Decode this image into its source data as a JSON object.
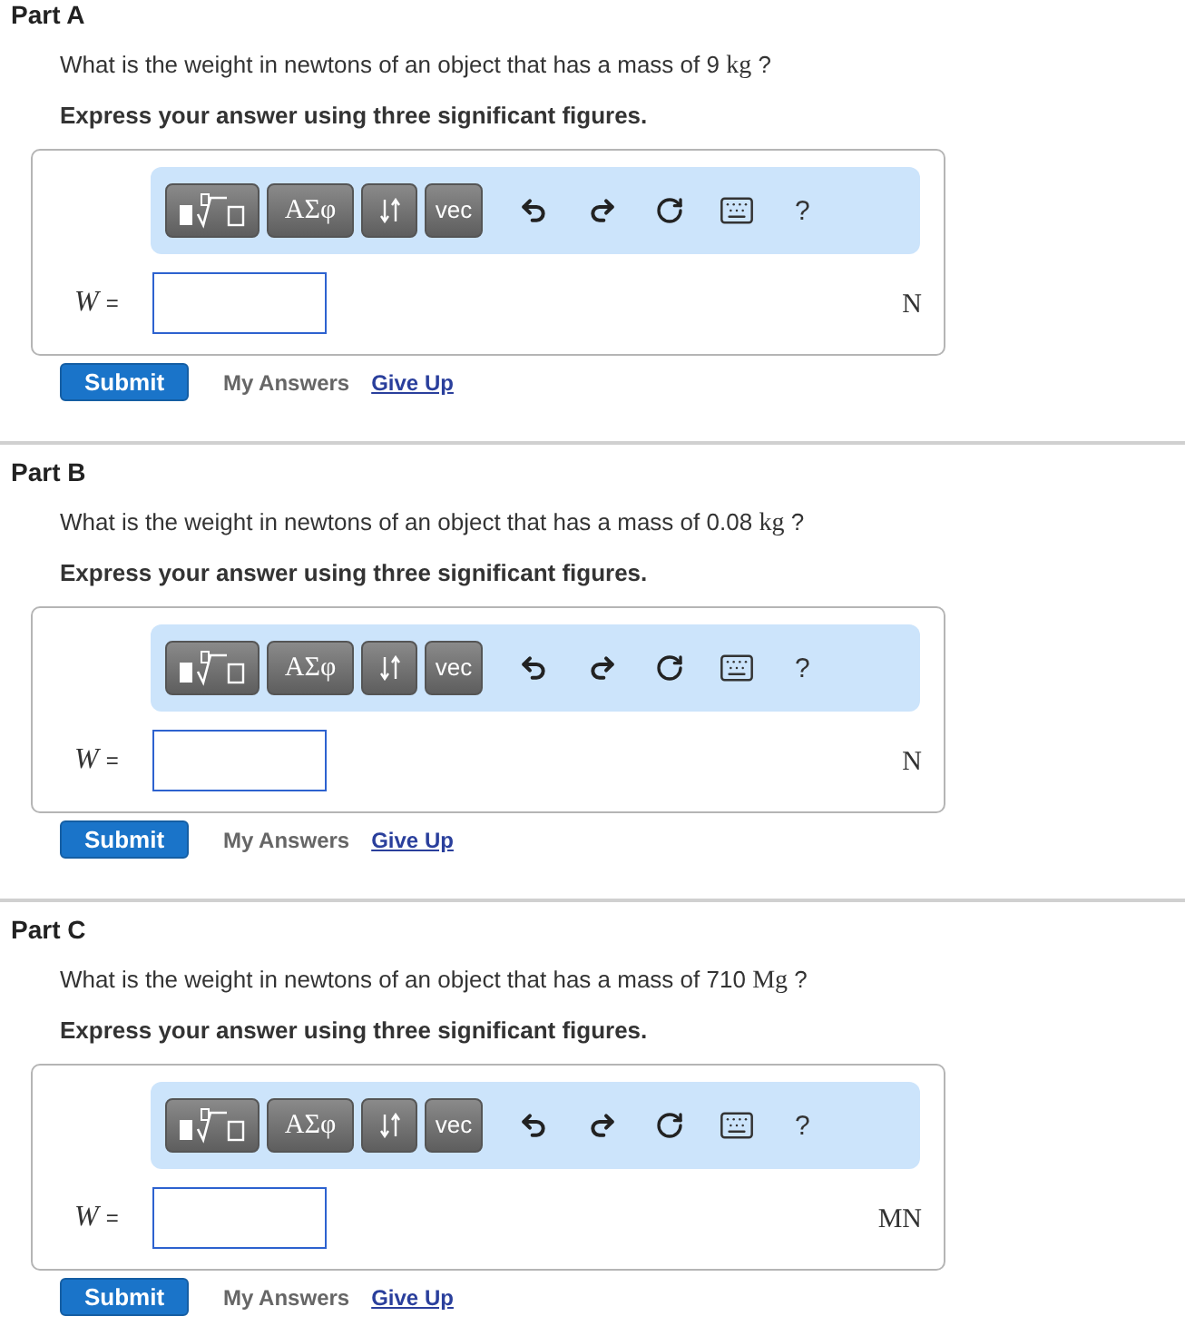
{
  "parts": [
    {
      "title": "Part A",
      "question": {
        "text": "What is the weight in newtons of an object that has a mass of 9",
        "unit": "kg",
        "end": "?"
      },
      "instruction": "Express your answer using three significant figures.",
      "toolbar": {
        "symbols": "ΑΣφ",
        "vector": "vec",
        "help": "?"
      },
      "answer": {
        "variable": "W",
        "equals": "=",
        "unit": "N"
      },
      "submit": "Submit",
      "my_answers": "My Answers",
      "give_up": "Give Up"
    },
    {
      "title": "Part B",
      "question": {
        "text": "What is the weight in newtons of an object that has a mass of 0.08",
        "unit": "kg",
        "end": "?"
      },
      "instruction": "Express your answer using three significant figures.",
      "toolbar": {
        "symbols": "ΑΣφ",
        "vector": "vec",
        "help": "?"
      },
      "answer": {
        "variable": "W",
        "equals": "=",
        "unit": "N"
      },
      "submit": "Submit",
      "my_answers": "My Answers",
      "give_up": "Give Up"
    },
    {
      "title": "Part C",
      "question": {
        "text": "What is the weight in newtons of an object that has a mass of 710",
        "unit": "Mg",
        "end": "?"
      },
      "instruction": "Express your answer using three significant figures.",
      "toolbar": {
        "symbols": "ΑΣφ",
        "vector": "vec",
        "help": "?"
      },
      "answer": {
        "variable": "W",
        "equals": "=",
        "unit": "MN"
      },
      "submit": "Submit",
      "my_answers": "My Answers",
      "give_up": "Give Up"
    }
  ]
}
